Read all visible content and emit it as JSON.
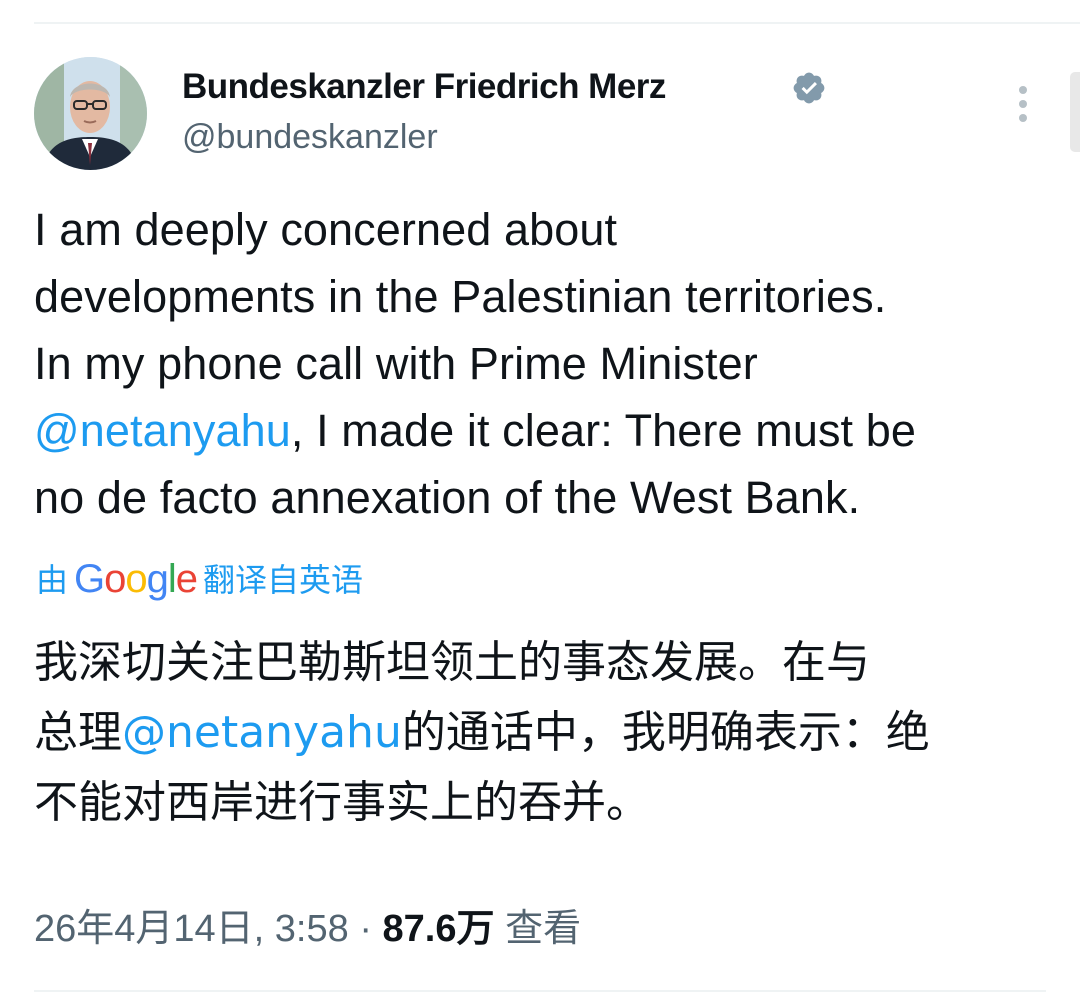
{
  "author": {
    "name": "Bundeskanzler Friedrich Merz",
    "handle": "@bundeskanzler",
    "verified": true
  },
  "tweet": {
    "lines": [
      [
        {
          "text": "I am deeply concerned about",
          "mention": false
        }
      ],
      [
        {
          "text": "developments in the Palestinian territories.",
          "mention": false
        }
      ],
      [
        {
          "text": "In my phone call with Prime Minister",
          "mention": false
        }
      ],
      [
        {
          "text": "@netanyahu",
          "mention": true
        },
        {
          "text": ", I made it clear: There must be",
          "mention": false
        }
      ],
      [
        {
          "text": "no de facto annexation of the West Bank.",
          "mention": false
        }
      ]
    ]
  },
  "translation": {
    "prefix": "由",
    "provider_logo": "Google",
    "suffix": "翻译自英语",
    "lines": [
      [
        {
          "text": "我深切关注巴勒斯坦领土的事态发展。在与",
          "mention": false
        }
      ],
      [
        {
          "text": "总理",
          "mention": false
        },
        {
          "text": "@netanyahu",
          "mention": true
        },
        {
          "text": "的通话中，我明确表示：绝",
          "mention": false
        }
      ],
      [
        {
          "text": "不能对西岸进行事实上的吞并。",
          "mention": false
        }
      ]
    ]
  },
  "meta": {
    "date": "26年4月14日, 3:58",
    "separator": "·",
    "views_count": "87.6万",
    "views_label": "查看"
  },
  "colors": {
    "link": "#1d9bf0",
    "text": "#0f1419",
    "muted": "#536471",
    "verified_badge": "#829aab",
    "google_blue": "#4285f4",
    "google_red": "#ea4335",
    "google_yellow": "#fbbc05",
    "google_green": "#34a853"
  },
  "icons": {
    "verified": "verified-badge-icon",
    "more": "more-options-icon"
  }
}
